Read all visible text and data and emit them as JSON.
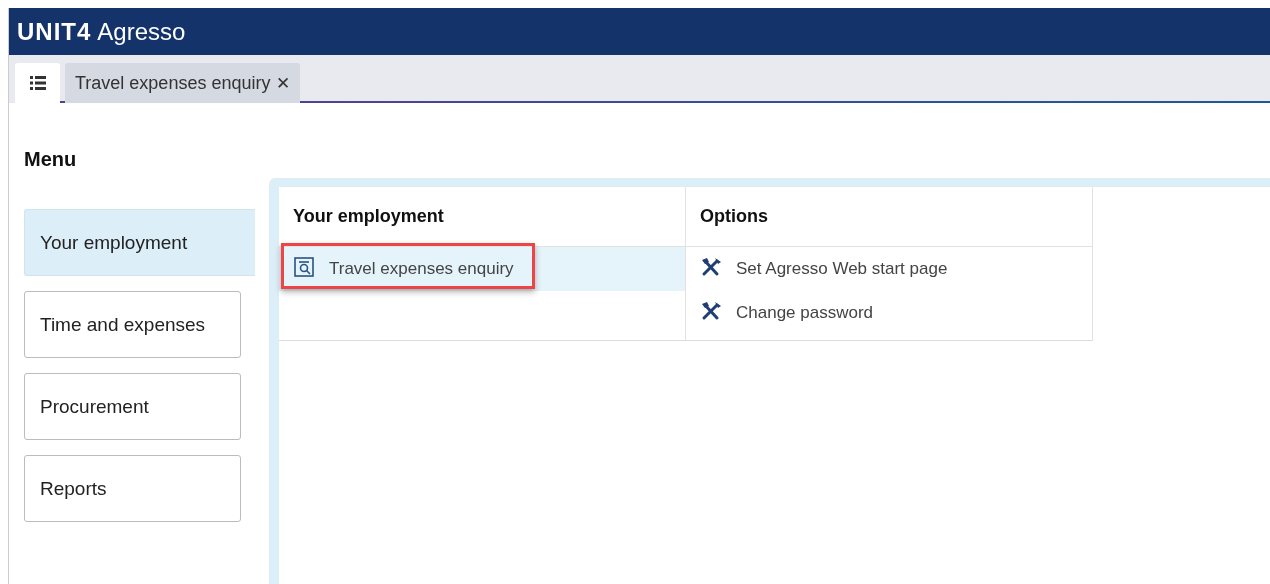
{
  "header": {
    "brand": "UNIT4",
    "product": "Agresso"
  },
  "tabs": [
    {
      "kind": "menu",
      "selected": true
    },
    {
      "kind": "page",
      "label": "Travel expenses enquiry",
      "close": "✕",
      "selected": false
    }
  ],
  "menu": {
    "title": "Menu",
    "items": [
      {
        "label": "Your employment",
        "selected": true
      },
      {
        "label": "Time and expenses",
        "selected": false
      },
      {
        "label": "Procurement",
        "selected": false
      },
      {
        "label": "Reports",
        "selected": false
      }
    ]
  },
  "columns": [
    {
      "heading": "Your employment",
      "links": [
        {
          "label": "Travel expenses enquiry",
          "kind": "enquiry",
          "selected": true,
          "highlighted": true
        }
      ]
    },
    {
      "heading": "Options",
      "links": [
        {
          "label": "Set Agresso Web start page",
          "kind": "tools",
          "selected": false,
          "highlighted": false
        },
        {
          "label": "Change password",
          "kind": "tools",
          "selected": false,
          "highlighted": false
        }
      ]
    }
  ]
}
